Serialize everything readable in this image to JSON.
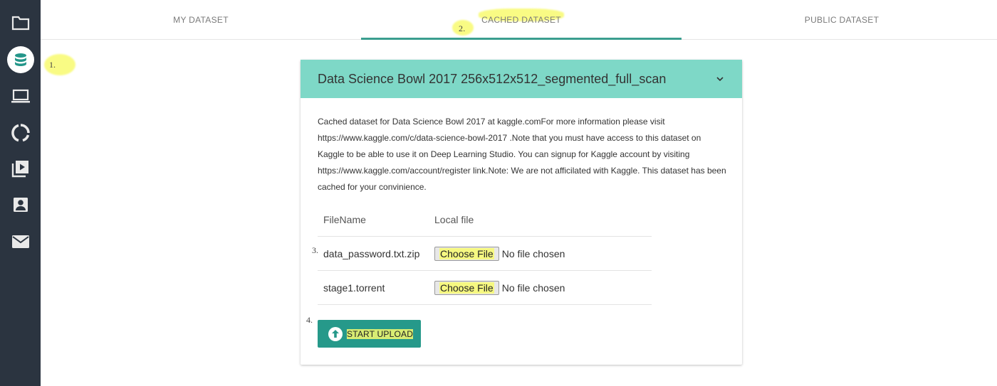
{
  "sidebar": {
    "items": [
      {
        "icon": "folder-icon"
      },
      {
        "icon": "database-icon",
        "active": true
      },
      {
        "icon": "laptop-icon"
      },
      {
        "icon": "donut-chart-icon"
      },
      {
        "icon": "video-library-icon"
      },
      {
        "icon": "account-box-icon"
      },
      {
        "icon": "mail-icon"
      }
    ]
  },
  "tabs": [
    {
      "label": "MY DATASET"
    },
    {
      "label": "CACHED DATASET",
      "active": true
    },
    {
      "label": "PUBLIC DATASET"
    }
  ],
  "annotations": {
    "step1": "1.",
    "step2": "2.",
    "step3": "3.",
    "step4": "4."
  },
  "card": {
    "title": "Data Science Bowl 2017 256x512x512_segmented_full_scan",
    "description": "Cached dataset for Data Science Bowl 2017 at kaggle.comFor more information please visit https://www.kaggle.com/c/data-science-bowl-2017 .Note that you must have access to this dataset on Kaggle to be able to use it on Deep Learning Studio. You can signup for Kaggle account by visiting https://www.kaggle.com/account/register link.Note: We are not afficilated with Kaggle. This dataset has been cached for your convinience.",
    "table": {
      "headers": [
        "FileName",
        "Local file"
      ],
      "rows": [
        {
          "filename": "data_password.txt.zip",
          "button": "Choose File",
          "status": "No file chosen"
        },
        {
          "filename": "stage1.torrent",
          "button": "Choose File",
          "status": "No file chosen"
        }
      ]
    },
    "upload_button": {
      "label": "START UPLOAD"
    }
  },
  "colors": {
    "sidebar": "#2b3440",
    "card_header": "#7ed8c7",
    "accent": "#26998a",
    "highlight": "#f8fa6e"
  }
}
